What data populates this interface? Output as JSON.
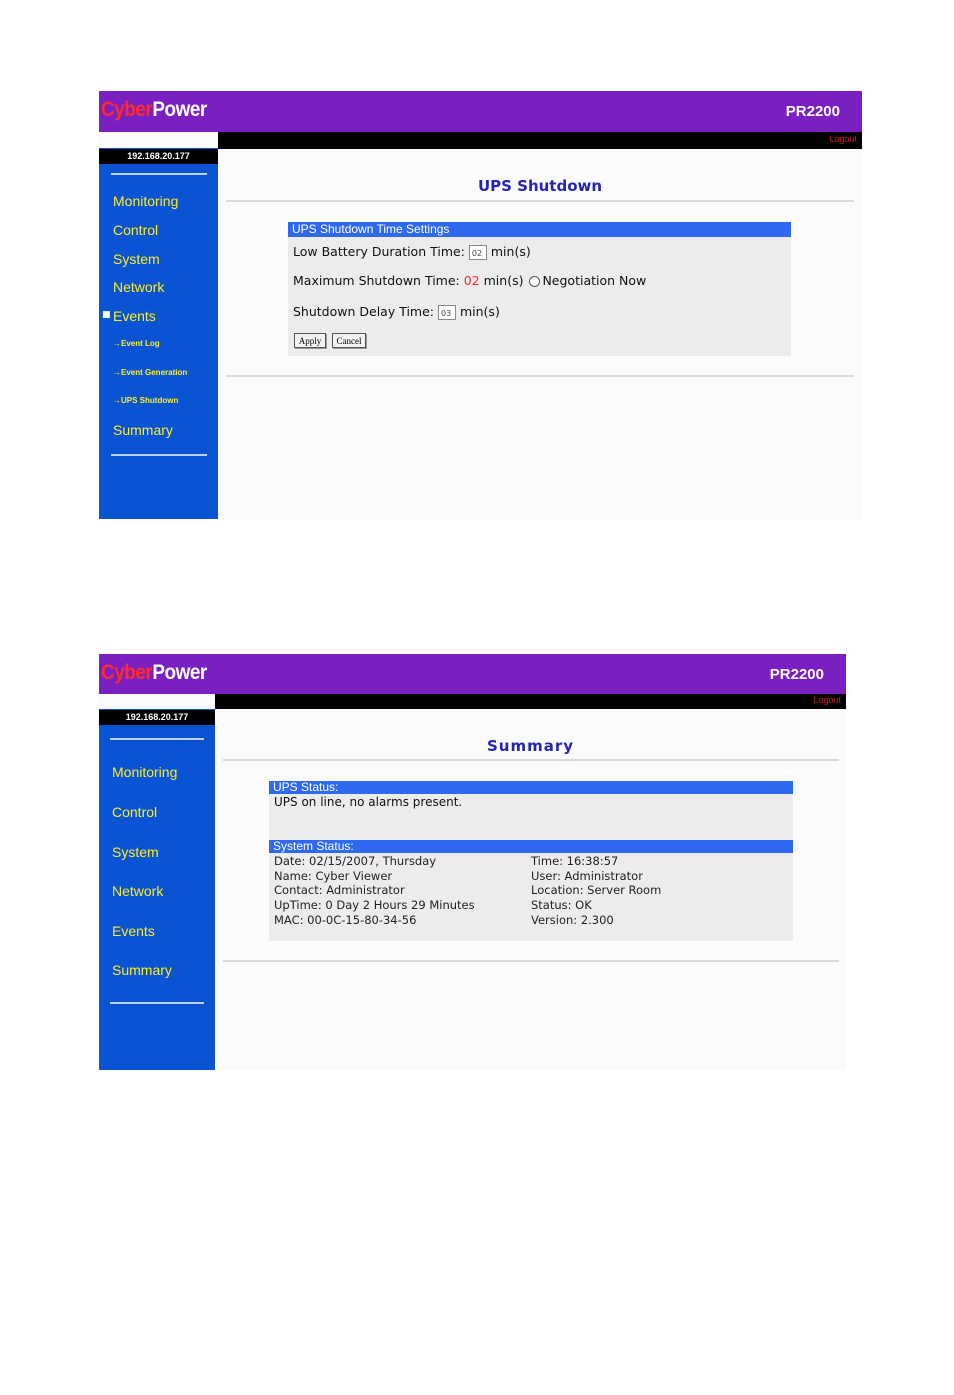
{
  "shot1": {
    "brand": {
      "part1": "Cyber",
      "part2": "Power"
    },
    "model": "PR2200",
    "logout": "Logout",
    "ip": "192.168.20.177",
    "nav": {
      "monitoring": "Monitoring",
      "control": "Control",
      "system": "System",
      "network": "Network",
      "events": "Events",
      "event_log": "→Event Log",
      "event_generation": "→Event Generation",
      "ups_shutdown": "→UPS Shutdown",
      "summary": "Summary"
    },
    "page_title": "UPS Shutdown",
    "panel_title": "UPS Shutdown Time Settings",
    "low_battery_label": "Low Battery Duration Time:",
    "low_battery_value": "02",
    "unit": "min(s)",
    "max_shutdown_label": "Maximum Shutdown Time:",
    "max_shutdown_value": "02",
    "negotiation_label": "Negotiation Now",
    "delay_label": "Shutdown Delay Time:",
    "delay_value": "03",
    "apply": "Apply",
    "cancel": "Cancel"
  },
  "shot2": {
    "brand": {
      "part1": "Cyber",
      "part2": "Power"
    },
    "model": "PR2200",
    "logout": "Logout",
    "ip": "192.168.20.177",
    "nav": {
      "monitoring": "Monitoring",
      "control": "Control",
      "system": "System",
      "network": "Network",
      "events": "Events",
      "summary": "Summary"
    },
    "page_title": "Summary",
    "ups_status_title": "UPS Status:",
    "ups_status_text": "UPS on line, no alarms present.",
    "system_status_title": "System Status:",
    "left": [
      "Date: 02/15/2007, Thursday",
      "Name: Cyber Viewer",
      "Contact: Administrator",
      "UpTime: 0 Day 2 Hours 29 Minutes",
      "MAC: 00-0C-15-80-34-56"
    ],
    "right": [
      "Time: 16:38:57",
      "User: Administrator",
      "Location: Server Room",
      "Status: OK",
      "Version: 2.300"
    ]
  }
}
